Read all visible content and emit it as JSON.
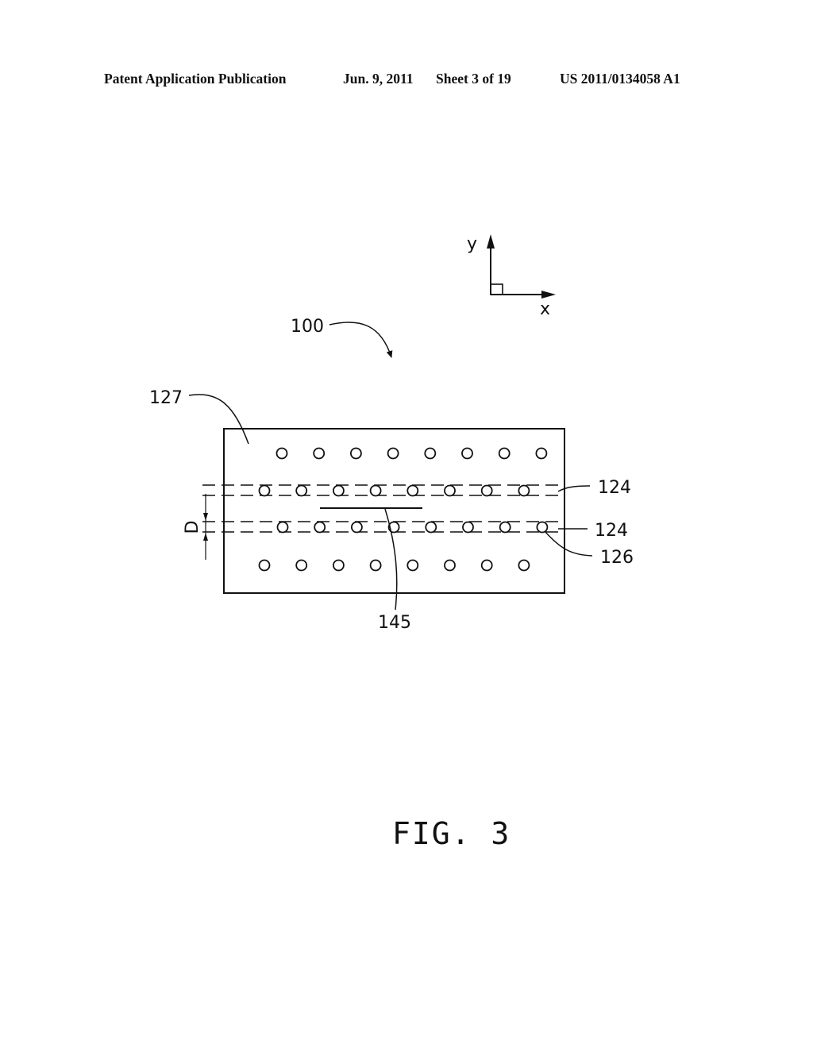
{
  "header": {
    "publication": "Patent Application Publication",
    "date": "Jun. 9, 2011",
    "sheet": "Sheet 3 of 19",
    "number": "US 2011/0134058 A1"
  },
  "figure": {
    "caption": "FIG. 3",
    "axes": {
      "y_label": "y",
      "x_label": "x"
    },
    "reference_labels": {
      "device": "100",
      "substrate": "127",
      "line_upper": "124",
      "line_lower": "124",
      "hole": "126",
      "region": "145",
      "spacing": "D"
    },
    "hole_rows": [
      {
        "row": "top",
        "count": 8,
        "on_dashed_line": false
      },
      {
        "row": "upper-dashed",
        "count": 8,
        "on_dashed_line": true
      },
      {
        "row": "lower-dashed",
        "count": 8,
        "on_dashed_line": true
      },
      {
        "row": "bottom",
        "count": 8,
        "on_dashed_line": false
      }
    ]
  }
}
